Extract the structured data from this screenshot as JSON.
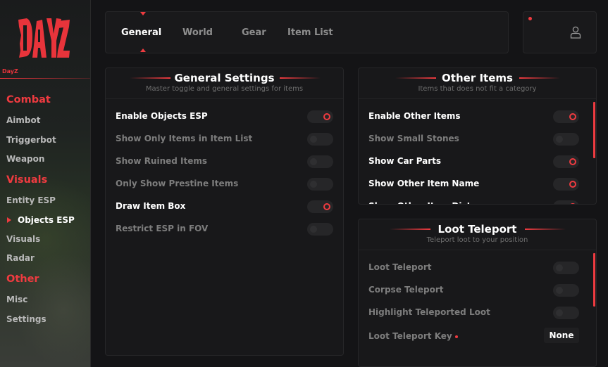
{
  "brand": {
    "logo_text": "DAYZ",
    "caption": "DayZ",
    "accent": "#ef3b40"
  },
  "sidebar": {
    "sections": [
      {
        "title": "Combat",
        "items": [
          "Aimbot",
          "Triggerbot",
          "Weapon"
        ]
      },
      {
        "title": "Visuals",
        "items": [
          "Entity ESP",
          "Objects ESP",
          "Visuals",
          "Radar"
        ]
      },
      {
        "title": "Other",
        "items": [
          "Misc",
          "Settings"
        ]
      }
    ],
    "active_item": "Objects ESP"
  },
  "tabs": [
    {
      "label": "General",
      "active": true
    },
    {
      "label": "World",
      "active": false
    },
    {
      "label": "Gear",
      "active": false
    },
    {
      "label": "Item List",
      "active": false
    }
  ],
  "user": {
    "icon": "user-icon"
  },
  "general_settings": {
    "title": "General Settings",
    "subtitle": "Master toggle and general settings for items",
    "rows": [
      {
        "label": "Enable Objects ESP",
        "on": true
      },
      {
        "label": "Show Only Items in Item List",
        "on": false
      },
      {
        "label": "Show Ruined Items",
        "on": false
      },
      {
        "label": "Only Show Prestine Items",
        "on": false
      },
      {
        "label": "Draw Item Box",
        "on": true
      },
      {
        "label": "Restrict ESP in FOV",
        "on": false
      }
    ]
  },
  "other_items": {
    "title": "Other Items",
    "subtitle": "Items that does not fit a category",
    "rows": [
      {
        "label": "Enable Other Items",
        "on": true
      },
      {
        "label": "Show Small Stones",
        "on": false
      },
      {
        "label": "Show Car Parts",
        "on": true
      },
      {
        "label": "Show Other Item Name",
        "on": true
      },
      {
        "label": "Show Other Item Distance",
        "on": true
      }
    ]
  },
  "loot_teleport": {
    "title": "Loot Teleport",
    "subtitle": "Teleport loot to your position",
    "rows": [
      {
        "label": "Loot Teleport",
        "on": false
      },
      {
        "label": "Corpse Teleport",
        "on": false
      },
      {
        "label": "Highlight Teleported Loot",
        "on": false
      }
    ],
    "key_label": "Loot Teleport Key",
    "key_value": "None"
  }
}
